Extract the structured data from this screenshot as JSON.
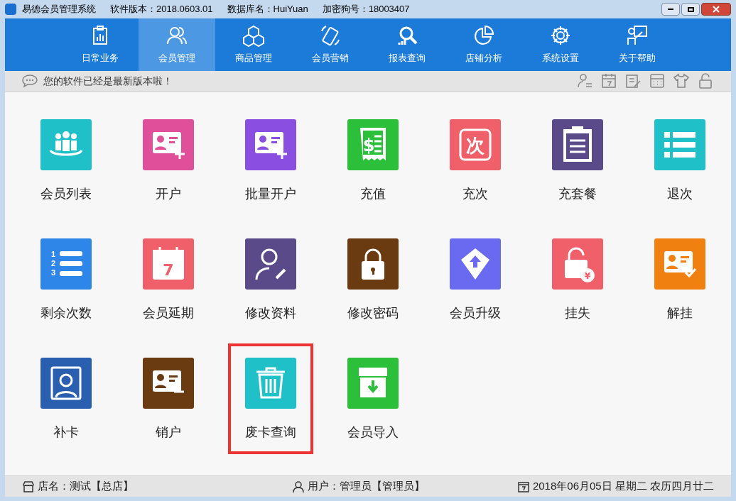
{
  "window": {
    "title": "易德会员管理系统",
    "version": "软件版本：2018.0603.01",
    "database": "数据库名：HuiYuan",
    "dongle": "加密狗号：18003407"
  },
  "nav": [
    {
      "label": "日常业务",
      "selected": false
    },
    {
      "label": "会员管理",
      "selected": true
    },
    {
      "label": "商品管理",
      "selected": false
    },
    {
      "label": "会员营销",
      "selected": false
    },
    {
      "label": "报表查询",
      "selected": false
    },
    {
      "label": "店铺分析",
      "selected": false
    },
    {
      "label": "系统设置",
      "selected": false
    },
    {
      "label": "关于帮助",
      "selected": false
    }
  ],
  "notice": "您的软件已经是最新版本啦！",
  "tiles": [
    {
      "label": "会员列表",
      "color": "#1fc0c8",
      "selected": false
    },
    {
      "label": "开户",
      "color": "#e0509a",
      "selected": false
    },
    {
      "label": "批量开户",
      "color": "#8a4fe0",
      "selected": false
    },
    {
      "label": "充值",
      "glyph": "$",
      "color": "#2bbf3a",
      "selected": false
    },
    {
      "label": "充次",
      "glyph": "次",
      "color": "#f0606a",
      "selected": false
    },
    {
      "label": "充套餐",
      "color": "#5a4a8a",
      "selected": false
    },
    {
      "label": "退次",
      "color": "#1fc0c8",
      "selected": false
    },
    {
      "label": "剩余次数",
      "glyph": "123",
      "color": "#2e86e8",
      "selected": false
    },
    {
      "label": "会员延期",
      "glyph": "7",
      "color": "#f0606a",
      "selected": false
    },
    {
      "label": "修改资料",
      "color": "#5a4a8a",
      "selected": false
    },
    {
      "label": "修改密码",
      "color": "#6a3a10",
      "selected": false
    },
    {
      "label": "会员升级",
      "color": "#6a6af0",
      "selected": false
    },
    {
      "label": "挂失",
      "glyph": "¥",
      "color": "#f0606a",
      "selected": false
    },
    {
      "label": "解挂",
      "color": "#f08010",
      "selected": false
    },
    {
      "label": "补卡",
      "color": "#2a5fb0",
      "selected": false
    },
    {
      "label": "销户",
      "color": "#6a3a10",
      "selected": false
    },
    {
      "label": "废卡查询",
      "color": "#1fc0c8",
      "selected": true
    },
    {
      "label": "会员导入",
      "color": "#2bbf3a",
      "selected": false
    }
  ],
  "status_bar": {
    "store": "店名：测试【总店】",
    "user": "用户：管理员【管理员】",
    "date": "2018年06月05日 星期二 农历四月廿二"
  }
}
